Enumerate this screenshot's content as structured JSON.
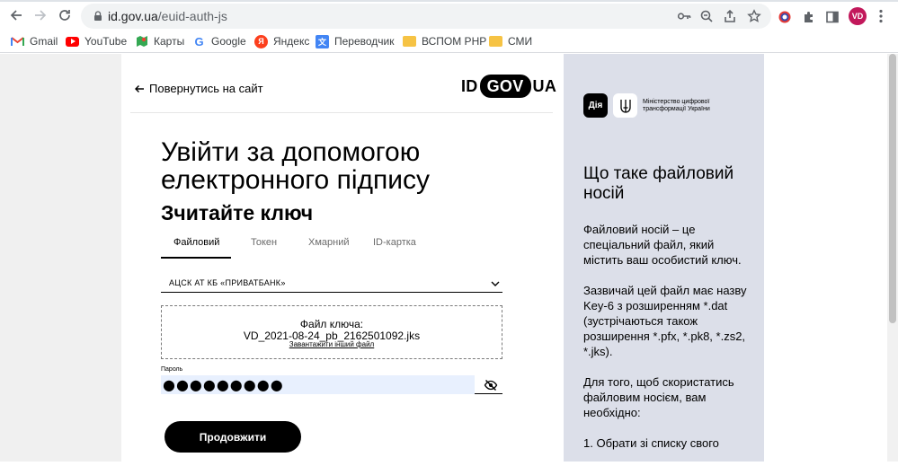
{
  "browser": {
    "url_host": "id.gov.ua",
    "url_path": "/euid-auth-js",
    "avatar": "VD",
    "avatar_color": "#c2185b"
  },
  "bookmarks": [
    {
      "label": "Gmail",
      "icon": "gmail-icon"
    },
    {
      "label": "YouTube",
      "icon": "youtube-icon"
    },
    {
      "label": "Карты",
      "icon": "maps-icon"
    },
    {
      "label": "Google",
      "icon": "google-icon"
    },
    {
      "label": "Яндекс",
      "icon": "yandex-icon"
    },
    {
      "label": "Переводчик",
      "icon": "translate-icon"
    },
    {
      "label": "ВСПОМ PHP",
      "icon": "folder-icon"
    },
    {
      "label": "СМИ",
      "icon": "folder-icon"
    }
  ],
  "header": {
    "back_label": "Повернутись на сайт",
    "logo_left": "ID",
    "logo_mid": "GOV",
    "logo_right": "UA"
  },
  "main": {
    "title": "Увійти за допомогою електронного підпису",
    "subtitle": "Зчитайте ключ",
    "tabs": [
      {
        "label": "Файловий",
        "active": true
      },
      {
        "label": "Токен",
        "active": false
      },
      {
        "label": "Хмарний",
        "active": false
      },
      {
        "label": "ID-картка",
        "active": false
      }
    ],
    "provider": "АЦСК АТ КБ «ПРИВАТБАНК»",
    "key_label": "Файл ключа:",
    "key_file": "VD_2021-08-24_pb_2162501092.jks",
    "upload_other": "Завантажити інший файл",
    "password_label": "Пароль",
    "password_value": "●●●●●●●●●",
    "continue_label": "Продовжити"
  },
  "info": {
    "diia": "Дія",
    "ministry": "Міністерство цифрової трансформації України",
    "title": "Що таке файловий носій",
    "p1": "Файловий носій – це спеціальний файл, який містить ваш особистий ключ.",
    "p2": "Зазвичай цей файл має назву Key-6 з розширенням *.dat (зустрічаються також розширення *.pfx, *.pk8, *.zs2, *.jks).",
    "p3": "Для того, щоб скористатись файловим носієм, вам необхідно:",
    "p4": "1. Обрати зі списку свого"
  },
  "colors": {
    "accent": "#000000",
    "panel": "#dcdfe9",
    "autofill": "#e8f0fe"
  }
}
